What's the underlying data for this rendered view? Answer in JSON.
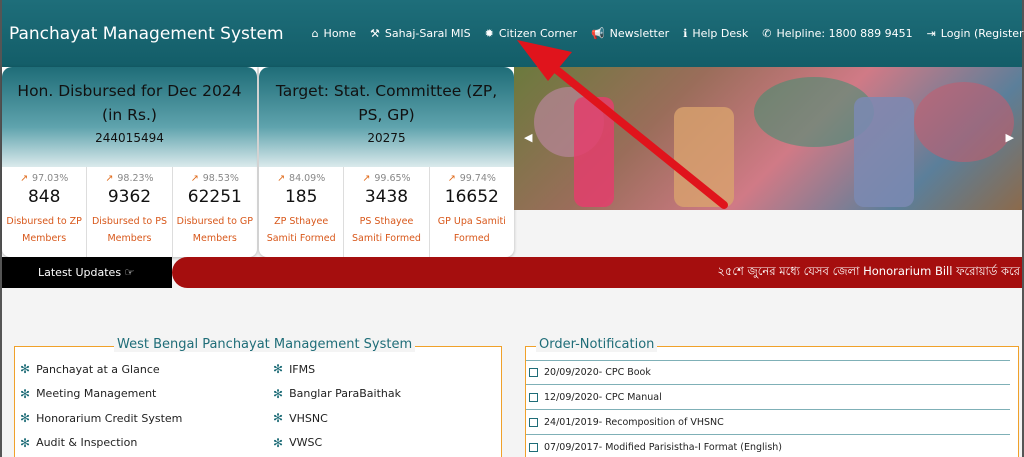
{
  "header": {
    "brand": "Panchayat Management System",
    "nav": [
      {
        "icon": "home-icon",
        "glyph": "⌂",
        "label": "Home"
      },
      {
        "icon": "gavel-icon",
        "glyph": "⚒",
        "label": "Sahaj-Saral MIS"
      },
      {
        "icon": "gear-icon",
        "glyph": "✹",
        "label": "Citizen Corner"
      },
      {
        "icon": "megaphone-icon",
        "glyph": "📢",
        "label": "Newsletter"
      },
      {
        "icon": "info-icon",
        "glyph": "ℹ",
        "label": "Help Desk"
      },
      {
        "icon": "phone-icon",
        "glyph": "✆",
        "label": "Helpline: 1800 889 9451"
      },
      {
        "icon": "login-icon",
        "glyph": "⇥",
        "label": "Login (Registered User)"
      }
    ]
  },
  "card_left": {
    "title": "Hon. Disbursed for Dec 2024 (in Rs.)",
    "value": "244015494",
    "stats": [
      {
        "pct": "97.03%",
        "num": "848",
        "label": "Disbursed to ZP Members"
      },
      {
        "pct": "98.23%",
        "num": "9362",
        "label": "Disbursed to PS Members"
      },
      {
        "pct": "98.53%",
        "num": "62251",
        "label": "Disbursed to GP Members"
      }
    ]
  },
  "card_right": {
    "title": "Target: Stat. Committee (ZP, PS, GP)",
    "value": "20275",
    "stats": [
      {
        "pct": "84.09%",
        "num": "185",
        "label": "ZP Sthayee Samiti Formed"
      },
      {
        "pct": "99.65%",
        "num": "3438",
        "label": "PS Sthayee Samiti Formed"
      },
      {
        "pct": "99.74%",
        "num": "16652",
        "label": "GP Upa Samiti Formed"
      }
    ]
  },
  "ticker": {
    "label": "Latest Updates ☞",
    "text": "২৫শে জুনের মধ্যে যেসব জেলা Honorarium Bill ফরোয়ার্ড করে"
  },
  "wbpms": {
    "title": "West Bengal Panchayat Management System",
    "left_items": [
      "Panchayat at a Glance",
      "Meeting Management",
      "Honorarium Credit System",
      "Audit & Inspection"
    ],
    "right_items": [
      "IFMS",
      "Banglar ParaBaithak",
      "VHSNC",
      "VWSC"
    ]
  },
  "orders": {
    "title": "Order-Notification",
    "items": [
      "20/09/2020- CPC Book",
      "12/09/2020- CPC Manual",
      "24/01/2019- Recomposition of VHSNC",
      "07/09/2017- Modified Parisistha-I Format (English)"
    ]
  },
  "colors": {
    "teal": "#1f6d78",
    "orange": "#f0a12a",
    "ticker_red": "#a50e0e",
    "annotation_red": "#e0141c"
  }
}
